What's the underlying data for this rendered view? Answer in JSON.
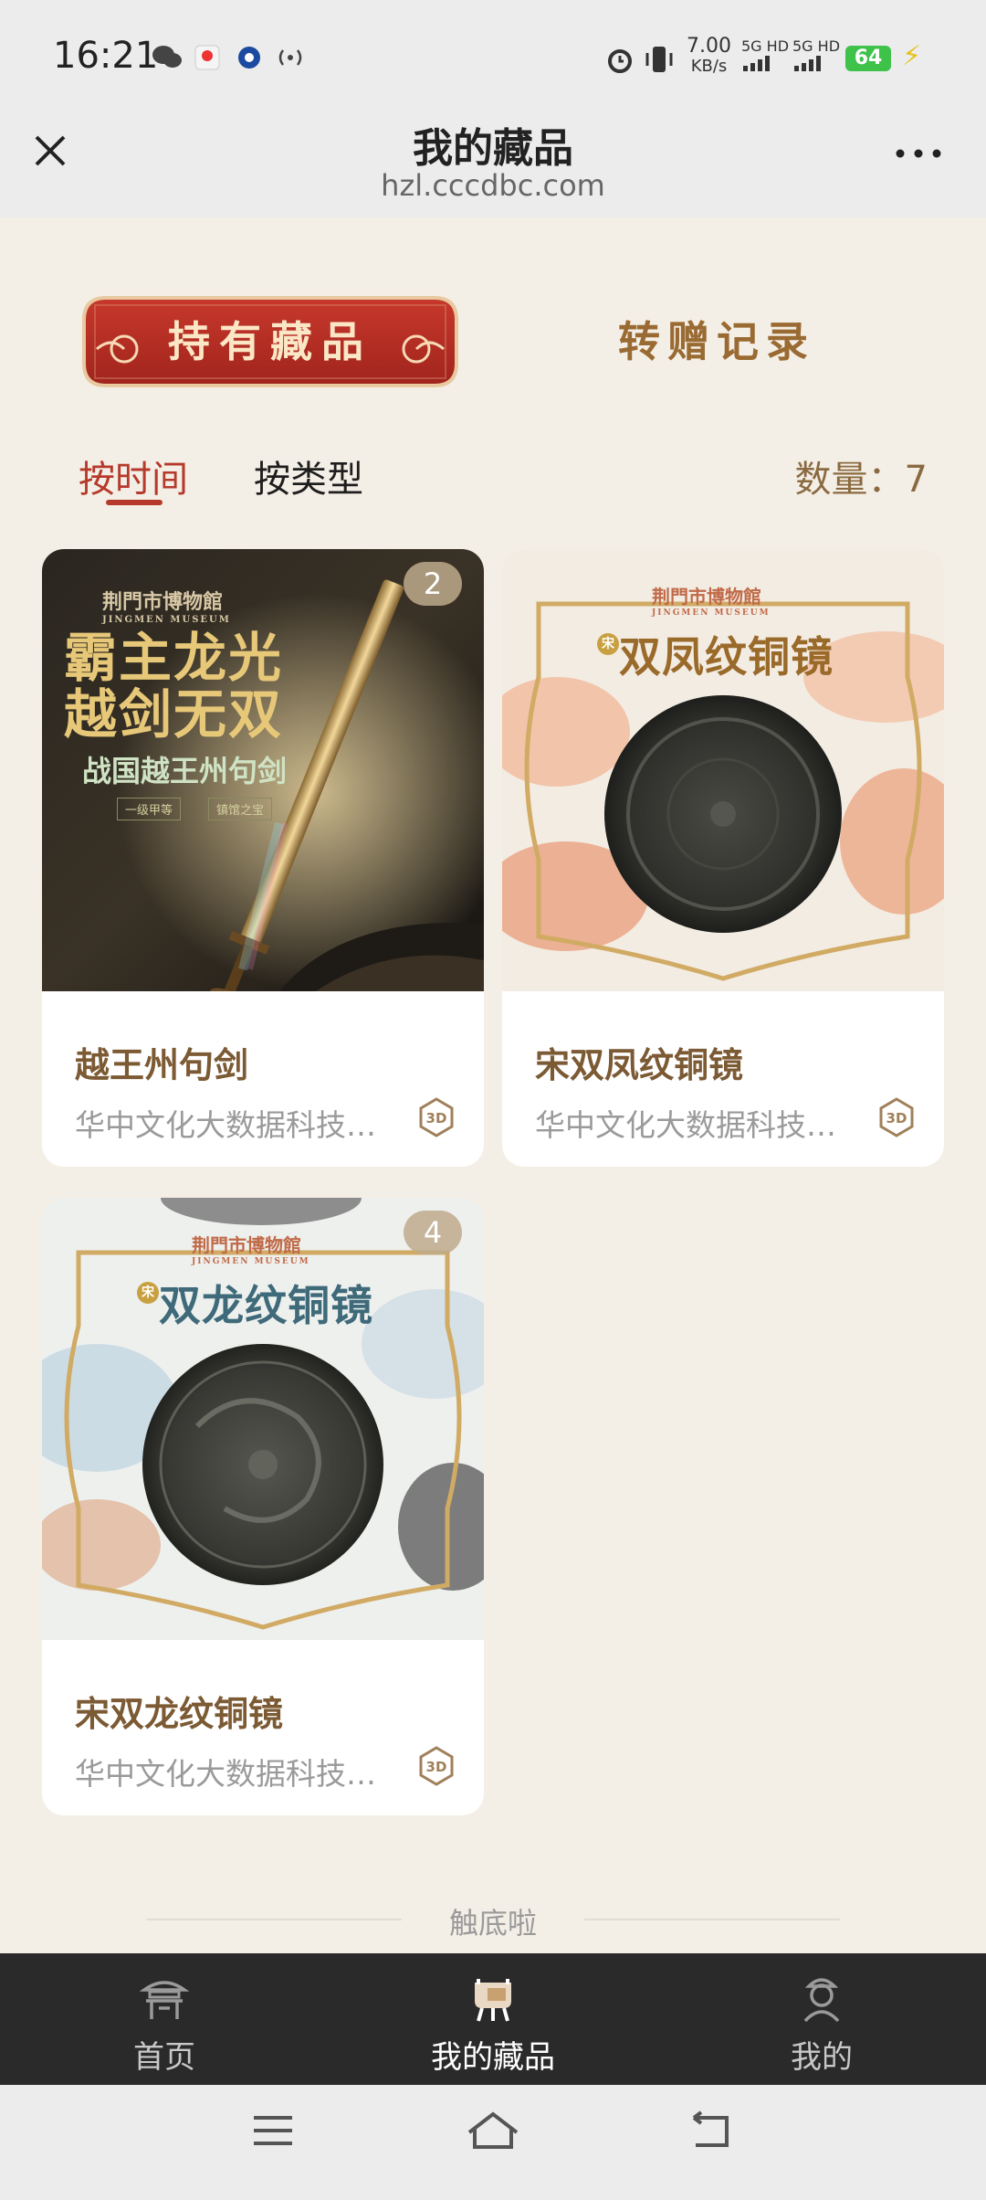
{
  "status_bar": {
    "time": "16:21",
    "net_speed_value": "7.00",
    "net_speed_unit": "KB/s",
    "sim1": "5G HD",
    "sim2": "5G HD",
    "battery": "64"
  },
  "header": {
    "title": "我的藏品",
    "url": "hzl.cccdbc.com"
  },
  "top_tabs": {
    "held": "持有藏品",
    "transfer": "转赠记录"
  },
  "sort_tabs": {
    "by_time": "按时间",
    "by_type": "按类型",
    "count_label": "数量：",
    "count_value": "7"
  },
  "items": [
    {
      "name": "越王州句剑",
      "publisher": "华中文化大数据科技有限公司",
      "badge": "2",
      "art": {
        "museum": "荆門市博物館",
        "museum_en": "JINGMEN MUSEUM",
        "headline1": "霸主龙光",
        "headline2": "越剑无双",
        "subtitle": "战国越王州句剑",
        "tag1": "一级甲等",
        "tag2": "镇馆之宝"
      }
    },
    {
      "name": "宋双凤纹铜镜",
      "publisher": "华中文化大数据科技有限公司",
      "badge": "",
      "art": {
        "museum": "荆門市博物館",
        "museum_en": "JINGMEN MUSEUM",
        "era": "宋",
        "headline": "双凤纹铜镜"
      }
    },
    {
      "name": "宋双龙纹铜镜",
      "publisher": "华中文化大数据科技有限公司",
      "badge": "4",
      "art": {
        "museum": "荆門市博物館",
        "museum_en": "JINGMEN MUSEUM",
        "era": "宋",
        "headline": "双龙纹铜镜"
      }
    }
  ],
  "end_text": "触底啦",
  "bottom_nav": {
    "home": "首页",
    "collection": "我的藏品",
    "mine": "我的"
  },
  "colors": {
    "page_bg": "#f4efe6",
    "accent_red": "#b63a2c",
    "gold_text": "#9a6a33",
    "nav_bg": "#2a2a2a"
  }
}
